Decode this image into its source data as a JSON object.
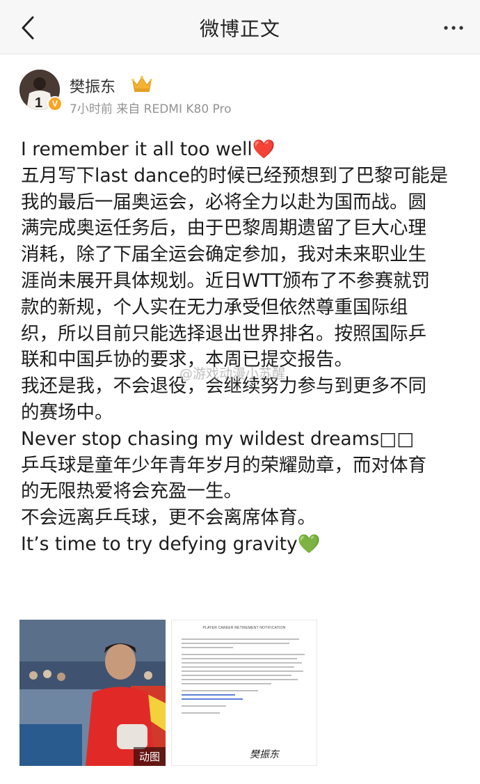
{
  "navbar": {
    "title": "微博正文",
    "back_icon": "chevron-left-icon",
    "more_icon": "more-horizontal-icon"
  },
  "author": {
    "name": "樊振东",
    "time": "7小时前",
    "source": "来自 REDMI K80 Pro",
    "verified_color": "#f6a623",
    "crown_color": "#f2b233"
  },
  "post": {
    "lines": [
      "I remember it all too well",
      "五月写下last dance的时候已经预想到了巴黎可能是",
      "我的最后一届奥运会，必将全力以赴为国而战。圆",
      "满完成奥运任务后，由于巴黎周期遗留了巨大心理",
      "消耗，除了下届全运会确定参加，我对未来职业生",
      "涯尚未展开具体规划。近日WTT颁布了不参赛就罚",
      "款的新规，个人实在无力承受但依然尊重国际组",
      "织，所以目前只能选择退出世界排名。按照国际乒",
      "联和中国乒协的要求，本周已提交报告。",
      "我还是我，不会退役，会继续努力参与到更多不同",
      "的赛场中。",
      "Never stop chasing my wildest dreams",
      "乒乓球是童年少年青年岁月的荣耀勋章，而对体育",
      "的无限热爱将会充盈一生。",
      "不会远离乒乓球，更不会离席体育。",
      "It’s time to try defying gravity"
    ],
    "red_heart": "❤️",
    "green_heart": "💚",
    "missing_glyphs": "□□"
  },
  "watermark": "@游戏动漫小苏醒",
  "media": {
    "gif_label": "动图",
    "doc_title": "PLAYER CAREER RETIREMENT NOTIFICATION",
    "doc_signature": "樊振东"
  }
}
